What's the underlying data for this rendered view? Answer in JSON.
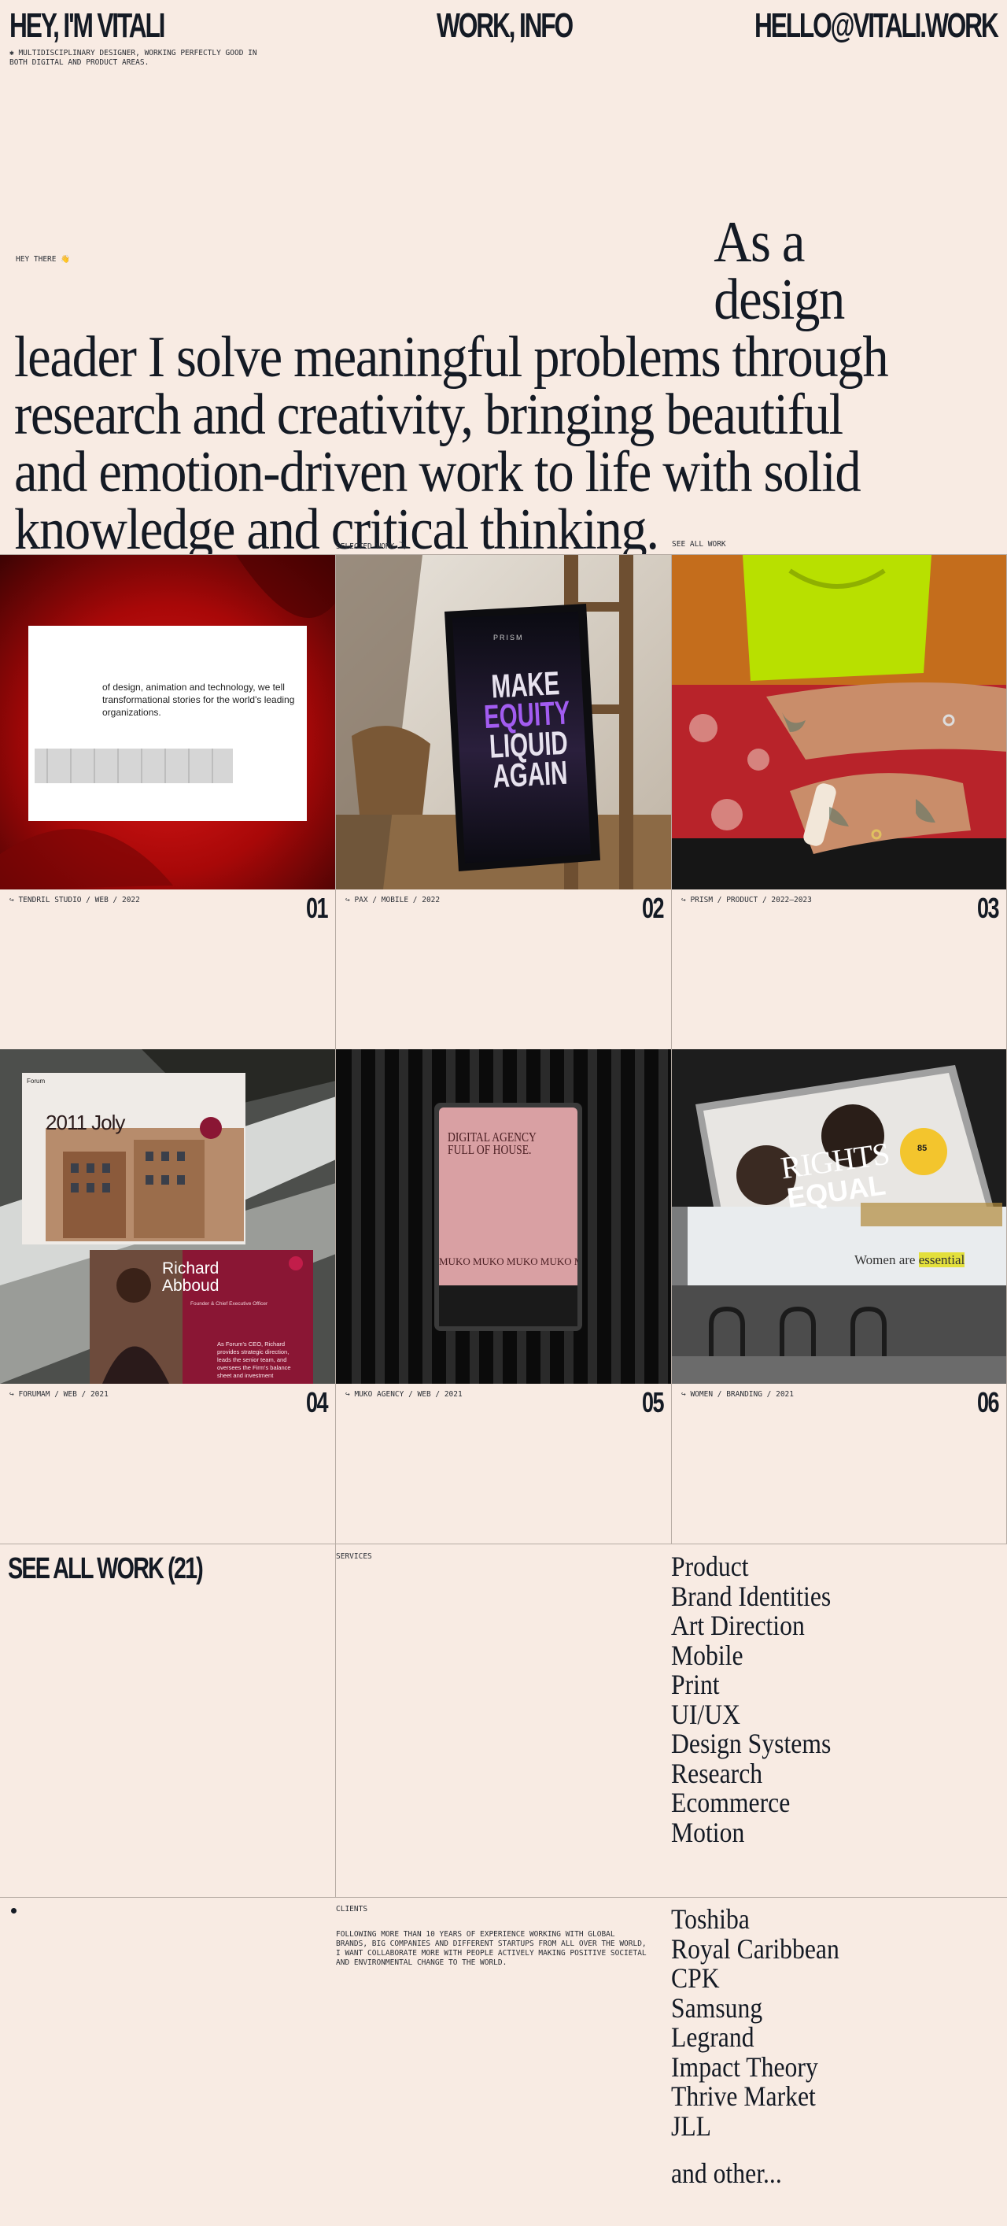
{
  "header": {
    "name": "HEY, I'M VITALI",
    "nav": "WORK, INFO",
    "email": "HELLO@VITALI.WORK",
    "tagline": "✱    MULTIDISCIPLINARY DESIGNER, WORKING PERFECTLY GOOD IN BOTH DIGITAL AND PRODUCT AREAS."
  },
  "hero": {
    "greeting": "HEY THERE",
    "greeting_icon": "👋",
    "line_first": "As a design",
    "line_rest": "leader I solve meaningful problems through research and creativity, bringing beautiful and emotion-driven work to life with solid knowledge and critical thinking."
  },
  "work": {
    "selected_label": "SELECTED WORK ⤵",
    "see_all_label": "SEE ALL WORK",
    "projects": [
      {
        "meta": "↪ TENDRIL STUDIO / WEB / 2022",
        "num": "01",
        "thumb_text": "of design, animation and technology, we tell transformational stories for the world's leading organizations."
      },
      {
        "meta": "↪ PAX / MOBILE / 2022",
        "num": "02",
        "thumb_brand": "PRISM",
        "thumb_l1": "MAKE",
        "thumb_l2": "EQUITY",
        "thumb_l3": "LIQUID",
        "thumb_l4": "AGAIN"
      },
      {
        "meta": "↪ PRISM / PRODUCT / 2022–2023",
        "num": "03"
      },
      {
        "meta": "↪ FORUMAM / WEB / 2021",
        "num": "04",
        "thumb_brand": "Forum",
        "thumb_title": "2011 Joly",
        "thumb_person": "Richard Abboud",
        "thumb_role": "Founder & Chief Executive Officer",
        "thumb_bio": "As Forum's CEO, Richard provides strategic direction, leads the senior team, and oversees the Firm's balance sheet and investment"
      },
      {
        "meta": "↪ MUKO AGENCY / WEB / 2021",
        "num": "05",
        "thumb_l1": "DIGITAL AGENCY",
        "thumb_l2": "FULL OF HOUSE.",
        "thumb_band": "MUKO MUKO MUKO MUKO MUKO MUKO MUKO"
      },
      {
        "meta": "↪ WOMEN / BRANDING / 2021",
        "num": "06",
        "thumb_rights": "RIGHTS",
        "thumb_equal": "EQUAL",
        "thumb_badge": "85",
        "thumb_billboard": "Women are",
        "thumb_billboard_hl": "essential"
      }
    ]
  },
  "services": {
    "see_all_big": "SEE ALL WORK (21)",
    "label": "SERVICES",
    "items": [
      "Product",
      "Brand Identities",
      "Art Direction",
      "Mobile",
      "Print",
      "UI/UX",
      "Design Systems",
      "Research",
      "Ecommerce",
      "Motion"
    ]
  },
  "clients": {
    "label": "CLIENTS",
    "text": "FOLLOWING MORE THAN 10 YEARS OF EXPERIENCE WORKING WITH GLOBAL BRANDS, BIG COMPANIES AND DIFFERENT STARTUPS FROM ALL OVER THE WORLD, I WANT COLLABORATE MORE  WITH PEOPLE ACTIVELY MAKING POSITIVE SOCIETAL AND ENVIRONMENTAL CHANGE TO THE WORLD.",
    "items": [
      "Toshiba",
      "Royal Caribbean",
      "CPK",
      "Samsung",
      "Legrand",
      "Impact Theory",
      "Thrive Market",
      "JLL"
    ],
    "other": "and other..."
  },
  "colors": {
    "background": "#f8ebe3",
    "text": "#141a24",
    "divider": "#b7aca4"
  }
}
